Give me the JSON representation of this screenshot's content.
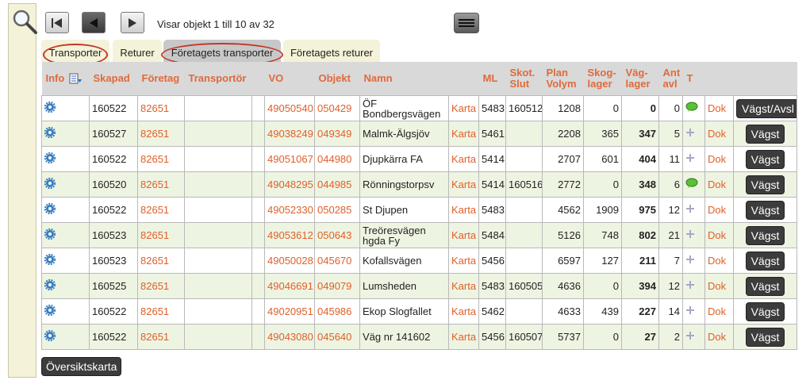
{
  "toolbar": {
    "status": "Visar objekt 1 till 10 av 32"
  },
  "tabs": [
    {
      "label": "Transporter",
      "active": false,
      "circled": true
    },
    {
      "label": "Returer",
      "active": false,
      "circled": false
    },
    {
      "label": "Företagets transporter",
      "active": true,
      "circled": true
    },
    {
      "label": "Företagets returer",
      "active": false,
      "circled": false
    }
  ],
  "columns": {
    "info": "Info",
    "skapad": "Skapad",
    "foretag": "Företag",
    "transportor": "Transportör",
    "vo": "VO",
    "objekt": "Objekt",
    "namn": "Namn",
    "ml": "ML",
    "skot1": "Skot.",
    "skot2": "Slut",
    "plan1": "Plan",
    "plan2": "Volym",
    "skog1": "Skog-",
    "skog2": "lager",
    "vag1": "Väg-",
    "vag2": "lager",
    "ant1": "Ant",
    "ant2": "avl",
    "t": "T"
  },
  "rows": [
    {
      "skapad": "160522",
      "foretag": "82651",
      "vo": "49050540",
      "objekt": "050429",
      "namn": "ÖF Bondbergsvägen",
      "karta": "Karta",
      "ml": "5483",
      "skot": "160512",
      "plan": "1208",
      "skog": "0",
      "vag": "0",
      "ant": "0",
      "t": "chat",
      "dok": "Dok",
      "action": "Vägst/Avsl"
    },
    {
      "skapad": "160527",
      "foretag": "82651",
      "vo": "49038249",
      "objekt": "049349",
      "namn": "Malmk-Älgsjöv",
      "karta": "Karta",
      "ml": "5461",
      "skot": "",
      "plan": "2208",
      "skog": "365",
      "vag": "347",
      "ant": "5",
      "t": "plus",
      "dok": "Dok",
      "action": "Vägst"
    },
    {
      "skapad": "160522",
      "foretag": "82651",
      "vo": "49051067",
      "objekt": "044980",
      "namn": "Djupkärra FA",
      "karta": "Karta",
      "ml": "5414",
      "skot": "",
      "plan": "2707",
      "skog": "601",
      "vag": "404",
      "ant": "11",
      "t": "plus",
      "dok": "Dok",
      "action": "Vägst"
    },
    {
      "skapad": "160520",
      "foretag": "82651",
      "vo": "49048295",
      "objekt": "044985",
      "namn": "Rönningstorpsv",
      "karta": "Karta",
      "ml": "5414",
      "skot": "160516",
      "plan": "2772",
      "skog": "0",
      "vag": "348",
      "ant": "6",
      "t": "chat",
      "dok": "Dok",
      "action": "Vägst"
    },
    {
      "skapad": "160522",
      "foretag": "82651",
      "vo": "49052330",
      "objekt": "050285",
      "namn": "St Djupen",
      "karta": "Karta",
      "ml": "5483",
      "skot": "",
      "plan": "4562",
      "skog": "1909",
      "vag": "975",
      "ant": "12",
      "t": "plus",
      "dok": "Dok",
      "action": "Vägst"
    },
    {
      "skapad": "160523",
      "foretag": "82651",
      "vo": "49053612",
      "objekt": "050643",
      "namn": "Treöresvägen hgda Fy",
      "karta": "Karta",
      "ml": "5484",
      "skot": "",
      "plan": "5126",
      "skog": "748",
      "vag": "802",
      "ant": "21",
      "t": "plus",
      "dok": "Dok",
      "action": "Vägst"
    },
    {
      "skapad": "160523",
      "foretag": "82651",
      "vo": "49050028",
      "objekt": "045670",
      "namn": "Kofallsvägen",
      "karta": "Karta",
      "ml": "5456",
      "skot": "",
      "plan": "6597",
      "skog": "127",
      "vag": "211",
      "ant": "7",
      "t": "plus",
      "dok": "Dok",
      "action": "Vägst"
    },
    {
      "skapad": "160525",
      "foretag": "82651",
      "vo": "49046691",
      "objekt": "049079",
      "namn": "Lumsheden",
      "karta": "Karta",
      "ml": "5483",
      "skot": "160505",
      "plan": "4636",
      "skog": "0",
      "vag": "394",
      "ant": "12",
      "t": "plus",
      "dok": "Dok",
      "action": "Vägst"
    },
    {
      "skapad": "160522",
      "foretag": "82651",
      "vo": "49020951",
      "objekt": "045986",
      "namn": "Ekop Slogfallet",
      "karta": "Karta",
      "ml": "5462",
      "skot": "",
      "plan": "4633",
      "skog": "439",
      "vag": "227",
      "ant": "14",
      "t": "plus",
      "dok": "Dok",
      "action": "Vägst"
    },
    {
      "skapad": "160522",
      "foretag": "82651",
      "vo": "49043080",
      "objekt": "045640",
      "namn": "Väg nr 141602",
      "karta": "Karta",
      "ml": "5456",
      "skot": "160507",
      "plan": "5737",
      "skog": "0",
      "vag": "27",
      "ant": "2",
      "t": "plus",
      "dok": "Dok",
      "action": "Vägst"
    }
  ],
  "footer": {
    "overview_button": "Översiktskarta"
  },
  "colors": {
    "accent": "#e0602a",
    "sidebar": "#f4f2d8",
    "row_alt": "#eef4e2",
    "circle": "#c0392b"
  }
}
